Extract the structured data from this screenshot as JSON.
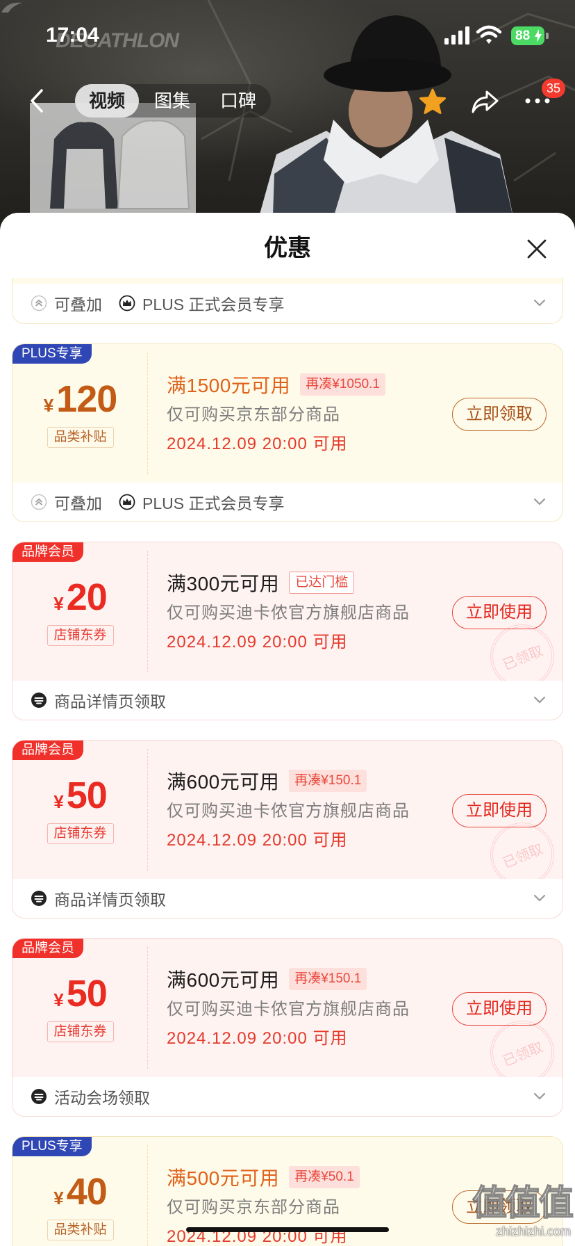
{
  "status_bar": {
    "time": "17:04",
    "battery": "88"
  },
  "hero": {
    "brand_logo": "DECATHLON"
  },
  "nav": {
    "tabs": [
      {
        "label": "视频",
        "selected": true
      },
      {
        "label": "图集",
        "selected": false
      },
      {
        "label": "口碑",
        "selected": false
      }
    ],
    "more_badge": "35",
    "icons": {
      "back": "chevron-left-icon",
      "favorite": "star-icon",
      "share": "share-icon",
      "more": "more-icon"
    }
  },
  "sheet": {
    "title": "优惠",
    "close_icon": "close-icon"
  },
  "colors": {
    "plus_tag": "#2f46b5",
    "brand_tag": "#f0302a",
    "plus_amount": "#c25b16",
    "brand_amount": "#ea2b22",
    "valid_time": "#e43a2c",
    "plus_card_bg": "#fffbea",
    "brand_card_bg": "#fff3f2",
    "battery": "#4cd964"
  },
  "coupons": [
    {
      "partial": true,
      "footer": [
        {
          "icon": "stackable-icon",
          "text": "可叠加"
        },
        {
          "icon": "crown-icon",
          "text": "PLUS 正式会员专享"
        }
      ]
    },
    {
      "type": "plus",
      "tag": "PLUS专享",
      "currency": "¥",
      "amount": "120",
      "category": "品类补贴",
      "condition": "满1500元可用",
      "badge": "再凑¥1050.1",
      "scope": "仅可购买京东部分商品",
      "valid_time": "2024.12.09 20:00 可用",
      "button": "立即领取",
      "footer": [
        {
          "icon": "stackable-icon",
          "text": "可叠加"
        },
        {
          "icon": "crown-icon",
          "text": "PLUS 正式会员专享"
        }
      ]
    },
    {
      "type": "brand",
      "tag": "品牌会员",
      "currency": "¥",
      "amount": "20",
      "category": "店铺东券",
      "condition": "满300元可用",
      "badge": "已达门槛",
      "scope": "仅可购买迪卡侬官方旗舰店商品",
      "valid_time": "2024.12.09 20:00 可用",
      "button": "立即使用",
      "stamp": "已领取",
      "footer": [
        {
          "icon": "jd-logo-icon",
          "text": "商品详情页领取"
        }
      ]
    },
    {
      "type": "brand",
      "tag": "品牌会员",
      "currency": "¥",
      "amount": "50",
      "category": "店铺东券",
      "condition": "满600元可用",
      "badge": "再凑¥150.1",
      "scope": "仅可购买迪卡侬官方旗舰店商品",
      "valid_time": "2024.12.09 20:00 可用",
      "button": "立即使用",
      "stamp": "已领取",
      "footer": [
        {
          "icon": "jd-logo-icon",
          "text": "商品详情页领取"
        }
      ]
    },
    {
      "type": "brand",
      "tag": "品牌会员",
      "currency": "¥",
      "amount": "50",
      "category": "店铺东券",
      "condition": "满600元可用",
      "badge": "再凑¥150.1",
      "scope": "仅可购买迪卡侬官方旗舰店商品",
      "valid_time": "2024.12.09 20:00 可用",
      "button": "立即使用",
      "stamp": "已领取",
      "footer": [
        {
          "icon": "jd-logo-icon",
          "text": "活动会场领取"
        }
      ]
    },
    {
      "type": "plus",
      "tag": "PLUS专享",
      "currency": "¥",
      "amount": "40",
      "category": "品类补贴",
      "condition": "满500元可用",
      "badge": "再凑¥50.1",
      "scope": "仅可购买京东部分商品",
      "valid_time": "2024.12.09 20:00 可用",
      "button": "立即领取"
    }
  ],
  "watermark": {
    "logo": "值值值",
    "site": "zhizhizhi.com"
  }
}
